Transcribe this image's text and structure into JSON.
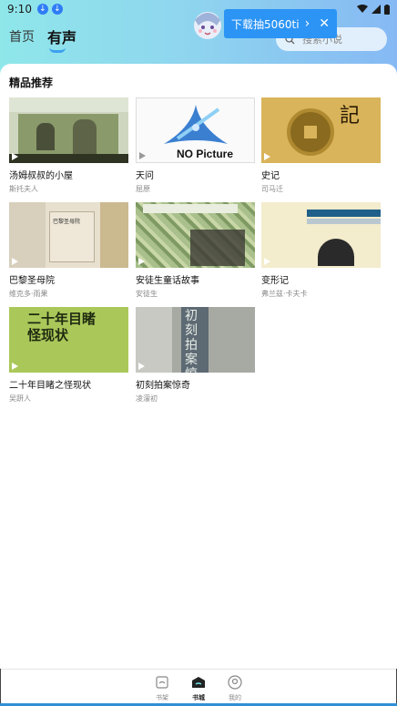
{
  "status": {
    "time": "9:10"
  },
  "header": {
    "tab_home": "首页",
    "tab_audio": "有声",
    "search_placeholder": "搜索小说"
  },
  "ad": {
    "text": "下载抽5060ti",
    "arrow": "›",
    "close": "✕"
  },
  "section": {
    "title": "精品推荐"
  },
  "books": [
    {
      "title": "汤姆叔叔的小屋",
      "author": "斯托夫人"
    },
    {
      "title": "天问",
      "author": "屈原",
      "cover_text": "NO Picture"
    },
    {
      "title": "史记",
      "author": "司马迁",
      "cover_text": "記"
    },
    {
      "title": "巴黎圣母院",
      "author": "维克多·雨果",
      "cover_text": "巴黎圣母院"
    },
    {
      "title": "安徒生童话故事",
      "author": "安徒生"
    },
    {
      "title": "变形记",
      "author": "弗兰兹·卡夫卡"
    },
    {
      "title": "二十年目睹之怪现状",
      "author": "吴趼人",
      "cover_text": "二十年目睹 怪现状"
    },
    {
      "title": "初刻拍案惊奇",
      "author": "凌濛初",
      "cover_text": "初刻拍案惊奇"
    }
  ],
  "nav": {
    "shelf": "书架",
    "store": "书城",
    "mine": "我的"
  },
  "colors": {
    "accent": "#2b94f5",
    "header_gradient_start": "#8fe7ea",
    "header_gradient_end": "#86b9f4"
  }
}
